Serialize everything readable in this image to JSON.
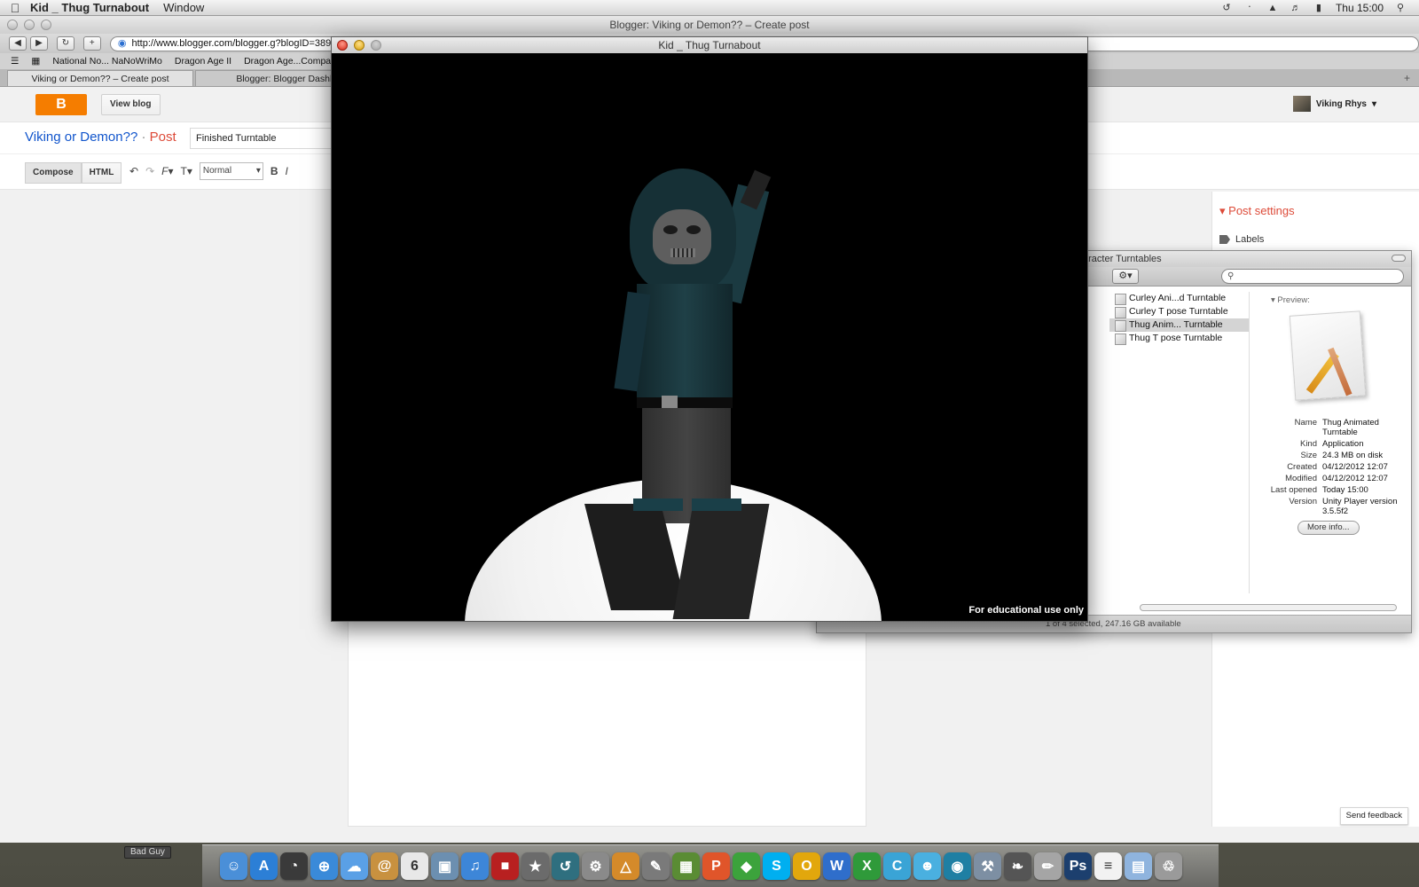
{
  "menubar": {
    "app_name": "Kid _ Thug Turnabout",
    "items": [
      "Window"
    ],
    "clock": "Thu 15:00",
    "status_icons": [
      "time-machine-icon",
      "bluetooth-icon",
      "wifi-icon",
      "volume-icon",
      "battery-icon",
      "spotlight-icon"
    ]
  },
  "browser": {
    "window_title": "Blogger: Viking or Demon?? – Create post",
    "url": "http://www.blogger.com/blogger.g?blogID=3896",
    "bookmarks": [
      "National No... NaNoWriMo",
      "Dragon Age II",
      "Dragon Age...Compa"
    ],
    "tabs": [
      {
        "label": "Viking or Demon?? – Create post",
        "active": true
      },
      {
        "label": "Blogger: Blogger Dashbo",
        "active": false
      }
    ]
  },
  "blogger": {
    "view_blog": "View blog",
    "user_name": "Viking Rhys",
    "blog_name": "Viking or Demon??",
    "separator": "·",
    "post_label": "Post",
    "post_title": "Finished Turntable",
    "mode_compose": "Compose",
    "mode_html": "HTML",
    "format_value": "Normal",
    "post_settings": "Post settings",
    "labels": "Labels",
    "send_feedback": "Send feedback"
  },
  "unity": {
    "window_title": "Kid _ Thug Turnabout",
    "watermark": "For educational use only"
  },
  "finder": {
    "title": "aracter Turntables",
    "files": [
      {
        "name": "Curley Ani...d Turntable",
        "selected": false
      },
      {
        "name": "Curley T pose Turntable",
        "selected": false
      },
      {
        "name": "Thug Anim... Turntable",
        "selected": true
      },
      {
        "name": "Thug T pose Turntable",
        "selected": false
      }
    ],
    "preview_label": "Preview:",
    "info": {
      "name_k": "Name",
      "name_v": "Thug Animated Turntable",
      "kind_k": "Kind",
      "kind_v": "Application",
      "size_k": "Size",
      "size_v": "24.3 MB on disk",
      "created_k": "Created",
      "created_v": "04/12/2012 12:07",
      "modified_k": "Modified",
      "modified_v": "04/12/2012 12:07",
      "opened_k": "Last opened",
      "opened_v": "Today 15:00",
      "version_k": "Version",
      "version_v": "Unity Player version 3.5.5f2"
    },
    "more_info": "More info...",
    "status": "1 of 4 selected, 247.16 GB available"
  },
  "dock": {
    "label": "Bad Guy",
    "icons": [
      {
        "name": "finder-icon",
        "color": "#4a8fd8",
        "glyph": "☺"
      },
      {
        "name": "app-store-icon",
        "color": "#2c7fd6",
        "glyph": "A"
      },
      {
        "name": "dashboard-icon",
        "color": "#3a3a3a",
        "glyph": "◔"
      },
      {
        "name": "safari-icon",
        "color": "#3a8ad9",
        "glyph": "⊕"
      },
      {
        "name": "ichat-icon",
        "color": "#5aa0e6",
        "glyph": "☁"
      },
      {
        "name": "address-book-icon",
        "color": "#c8913f",
        "glyph": "@"
      },
      {
        "name": "calendar-icon",
        "color": "#e8e8e8",
        "glyph": "6"
      },
      {
        "name": "iphoto-icon",
        "color": "#6c8fb0",
        "glyph": "▣"
      },
      {
        "name": "itunes-icon",
        "color": "#3d86d8",
        "glyph": "♫"
      },
      {
        "name": "photo-booth-icon",
        "color": "#b82020",
        "glyph": "■"
      },
      {
        "name": "imovie-icon",
        "color": "#6b6b6b",
        "glyph": "★"
      },
      {
        "name": "time-machine-icon",
        "color": "#2f6f7f",
        "glyph": "↺"
      },
      {
        "name": "system-preferences-icon",
        "color": "#8a8a8a",
        "glyph": "⚙"
      },
      {
        "name": "keynote-icon",
        "color": "#d48a2a",
        "glyph": "△"
      },
      {
        "name": "inkscape-icon",
        "color": "#7a7a7a",
        "glyph": "✎"
      },
      {
        "name": "minecraft-icon",
        "color": "#5a8c34",
        "glyph": "▦"
      },
      {
        "name": "presenter-icon",
        "color": "#e0552a",
        "glyph": "P"
      },
      {
        "name": "sims-icon",
        "color": "#3ca33c",
        "glyph": "◆"
      },
      {
        "name": "skype-icon",
        "color": "#00aff0",
        "glyph": "S"
      },
      {
        "name": "office-outlook-icon",
        "color": "#e2a70c",
        "glyph": "O"
      },
      {
        "name": "word-icon",
        "color": "#2f6ecb",
        "glyph": "W"
      },
      {
        "name": "excel-icon",
        "color": "#2f9a3a",
        "glyph": "X"
      },
      {
        "name": "cyberduck-icon",
        "color": "#3aa4d6",
        "glyph": "C"
      },
      {
        "name": "messenger-icon",
        "color": "#4ab0e0",
        "glyph": "☻"
      },
      {
        "name": "network-icon",
        "color": "#1f7fa3",
        "glyph": "◉"
      },
      {
        "name": "utility-icon",
        "color": "#7d8fa3",
        "glyph": "⚒"
      },
      {
        "name": "script-icon",
        "color": "#555555",
        "glyph": "❧"
      },
      {
        "name": "preview-app-icon",
        "color": "#a5a5a5",
        "glyph": "✏"
      },
      {
        "name": "photoshop-icon",
        "color": "#1c3f6e",
        "glyph": "Ps"
      },
      {
        "name": "document-icon",
        "color": "#f2f2f2",
        "glyph": "≡"
      },
      {
        "name": "folder-icon",
        "color": "#8fb4de",
        "glyph": "▤"
      },
      {
        "name": "trash-icon",
        "color": "#9a9a9a",
        "glyph": "♲"
      }
    ]
  }
}
